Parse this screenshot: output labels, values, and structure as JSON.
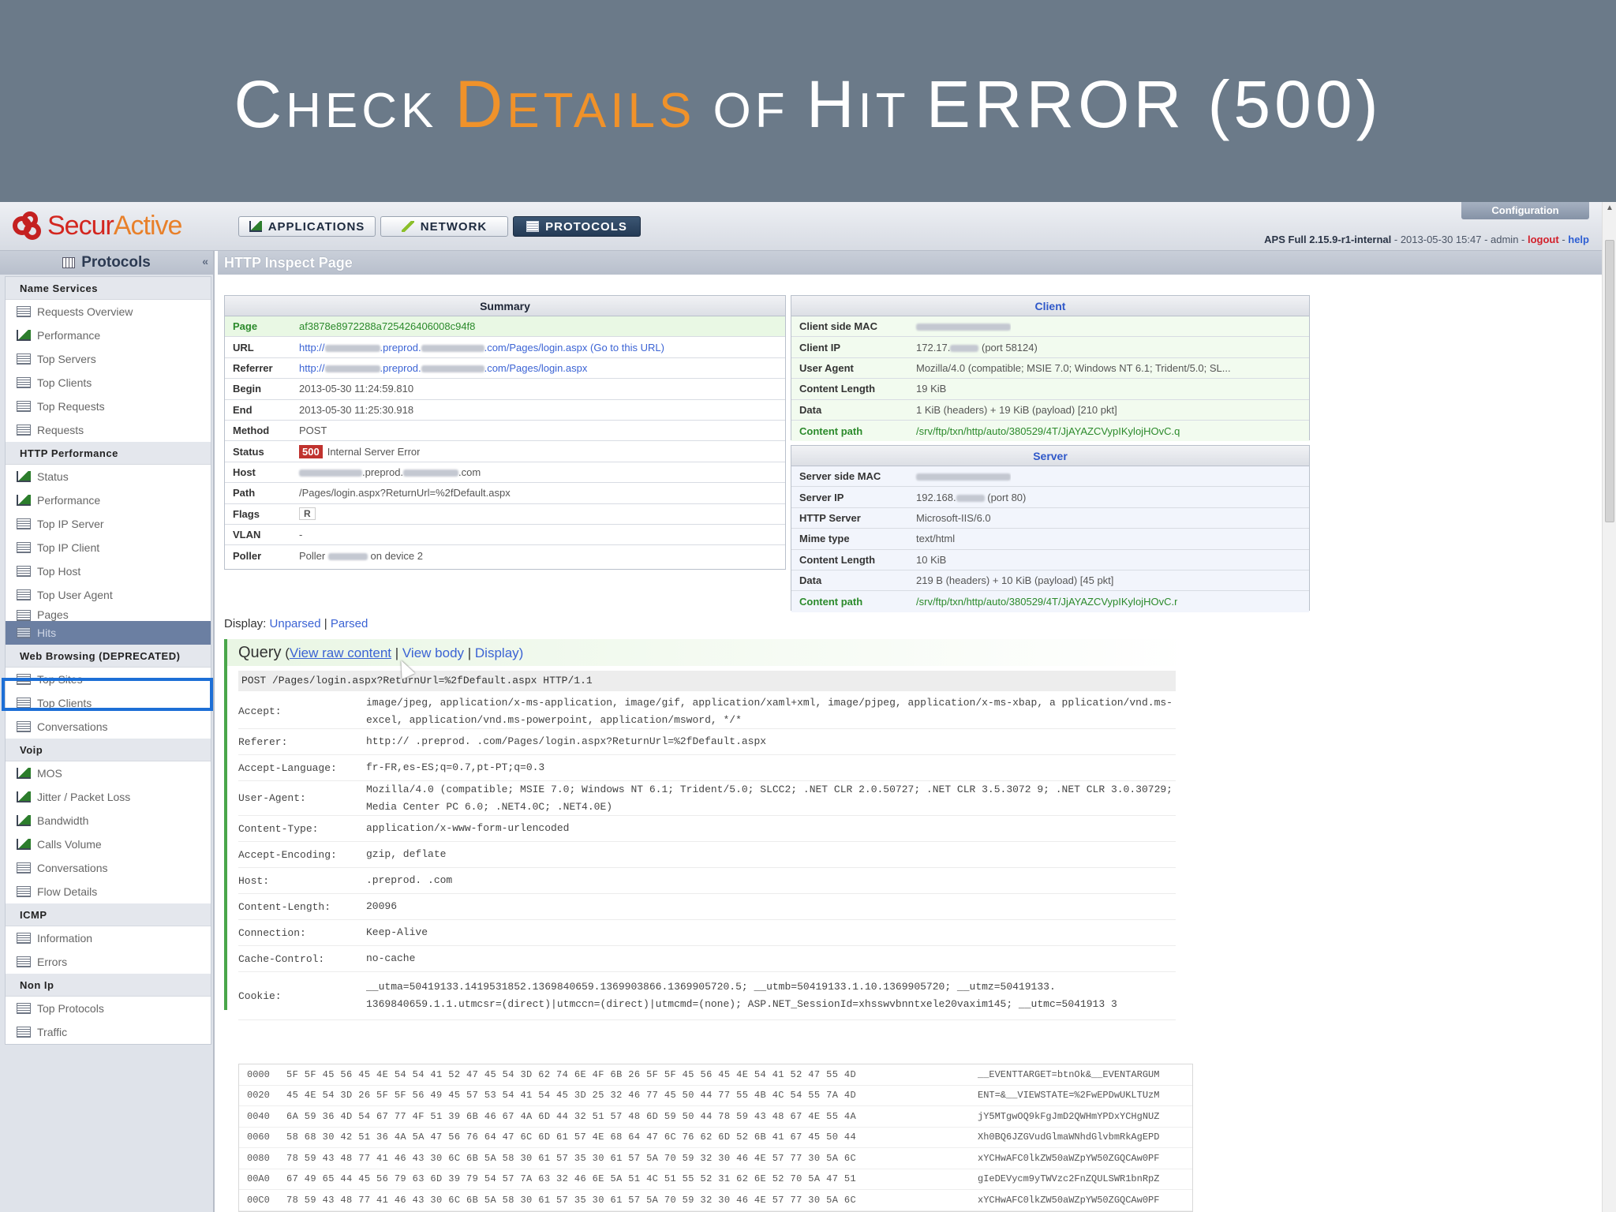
{
  "slide": {
    "title_parts": [
      "C",
      "HECK ",
      "D",
      "ETAILS",
      " OF ",
      "H",
      "IT ",
      "ERROR (500)"
    ]
  },
  "app": {
    "logo": {
      "part1": "Secur",
      "part2": "Active"
    },
    "tabs": [
      {
        "label": "APPLICATIONS",
        "icon": "chart-icon"
      },
      {
        "label": "NETWORK",
        "icon": "pencil-icon"
      },
      {
        "label": "PROTOCOLS",
        "icon": "document-icon",
        "active": true
      }
    ],
    "config_label": "Configuration",
    "status": {
      "version": "APS Full 2.15.9-r1-internal",
      "timestamp": " - 2013-05-30 15:47 - admin - ",
      "logout": "logout",
      "sep": " - ",
      "help": "help"
    }
  },
  "sidebar": {
    "title": "Protocols",
    "sections": [
      {
        "title": "Name Services",
        "items": [
          "Requests Overview",
          "Performance",
          "Top Servers",
          "Top Clients",
          "Top Requests",
          "Requests"
        ]
      },
      {
        "title": "HTTP Performance",
        "items": [
          "Status",
          "Performance",
          "Top IP Server",
          "Top IP Client",
          "Top Host",
          "Top User Agent",
          "Pages",
          "Hits"
        ]
      },
      {
        "title": "Web Browsing (DEPRECATED)",
        "items": [
          "Top Sites",
          "Top Clients",
          "Conversations"
        ]
      },
      {
        "title": "Voip",
        "items": [
          "MOS",
          "Jitter / Packet Loss",
          "Bandwidth",
          "Calls Volume",
          "Conversations",
          "Flow Details"
        ]
      },
      {
        "title": "ICMP",
        "items": [
          "Information",
          "Errors"
        ]
      },
      {
        "title": "Non Ip",
        "items": [
          "Top Protocols",
          "Traffic"
        ]
      }
    ]
  },
  "main": {
    "page_title": "HTTP Inspect Page",
    "summary": {
      "title": "Summary",
      "page_label": "Page",
      "page_value": "af3878e8972288a725426406008c94f8",
      "url_label": "URL",
      "url_prefix": "http://",
      "url_mid": ".preprod.",
      "url_suffix": ".com/Pages/login.aspx",
      "url_go": "(Go to this URL)",
      "referrer_label": "Referrer",
      "referrer_prefix": "http://",
      "referrer_mid": ".preprod.",
      "referrer_suffix": ".com/Pages/login.aspx",
      "begin_label": "Begin",
      "begin_value": "2013-05-30 11:24:59.810",
      "end_label": "End",
      "end_value": "2013-05-30 11:25:30.918",
      "method_label": "Method",
      "method_value": "POST",
      "status_label": "Status",
      "status_code": "500",
      "status_text": "Internal Server Error",
      "host_label": "Host",
      "host_mid": ".preprod.",
      "host_suffix": ".com",
      "path_label": "Path",
      "path_value": "/Pages/login.aspx?ReturnUrl=%2fDefault.aspx",
      "flags_label": "Flags",
      "flags_value": "R",
      "vlan_label": "VLAN",
      "vlan_value": "-",
      "poller_label": "Poller",
      "poller_prefix": "Poller",
      "poller_suffix": "on device 2"
    },
    "client": {
      "title": "Client",
      "mac_label": "Client side MAC",
      "ip_label": "Client IP",
      "ip_value": "172.17.",
      "ip_port": "(port 58124)",
      "ua_label": "User Agent",
      "ua_value": "Mozilla/4.0 (compatible; MSIE 7.0; Windows NT 6.1; Trident/5.0; SL...",
      "cl_label": "Content Length",
      "cl_value": "19 KiB",
      "data_label": "Data",
      "data_value": "1 KiB (headers) + 19 KiB (payload) [210 pkt]",
      "cp_label": "Content path",
      "cp_value": "/srv/ftp/txn/http/auto/380529/4T/JjAYAZCVypIKylojHOvC.q"
    },
    "server": {
      "title": "Server",
      "mac_label": "Server side MAC",
      "ip_label": "Server IP",
      "ip_value": "192.168.",
      "ip_port": "(port 80)",
      "http_label": "HTTP Server",
      "http_value": "Microsoft-IIS/6.0",
      "mime_label": "Mime type",
      "mime_value": "text/html",
      "cl_label": "Content Length",
      "cl_value": "10 KiB",
      "data_label": "Data",
      "data_value": "219 B (headers) + 10 KiB (payload) [45 pkt]",
      "cp_label": "Content path",
      "cp_value": "/srv/ftp/txn/http/auto/380529/4T/JjAYAZCVypIKylojHOvC.r"
    },
    "display": {
      "label": "Display:",
      "unparsed": "Unparsed",
      "sep": " | ",
      "parsed": "Parsed"
    },
    "query": {
      "title": "Query",
      "open": " (",
      "view_raw": "View raw content",
      "view_body": "View body",
      "display": "Display",
      "sep": " | ",
      "close": ")",
      "request_line": "POST /Pages/login.aspx?ReturnUrl=%2fDefault.aspx HTTP/1.1",
      "headers": [
        {
          "name": "Accept:",
          "value": "image/jpeg, application/x-ms-application, image/gif, application/xaml+xml, image/pjpeg, application/x-ms-xbap, a pplication/vnd.ms-excel, application/vnd.ms-powerpoint, application/msword, */*"
        },
        {
          "name": "Referer:",
          "value": "http://          .preprod.             .com/Pages/login.aspx?ReturnUrl=%2fDefault.aspx"
        },
        {
          "name": "Accept-Language:",
          "value": "fr-FR,es-ES;q=0.7,pt-PT;q=0.3"
        },
        {
          "name": "User-Agent:",
          "value": "Mozilla/4.0 (compatible; MSIE 7.0; Windows NT 6.1; Trident/5.0; SLCC2; .NET CLR 2.0.50727; .NET CLR 3.5.3072 9; .NET CLR 3.0.30729; Media Center PC 6.0; .NET4.0C; .NET4.0E)"
        },
        {
          "name": "Content-Type:",
          "value": "application/x-www-form-urlencoded"
        },
        {
          "name": "Accept-Encoding:",
          "value": "gzip, deflate"
        },
        {
          "name": "Host:",
          "value": "          .preprod.          .com"
        },
        {
          "name": "Content-Length:",
          "value": "20096"
        },
        {
          "name": "Connection:",
          "value": "Keep-Alive"
        },
        {
          "name": "Cache-Control:",
          "value": "no-cache"
        },
        {
          "name": "Cookie:",
          "value": "__utma=50419133.1419531852.1369840659.1369903866.1369905720.5; __utmb=50419133.1.10.1369905720; __utmz=50419133. 1369840659.1.1.utmcsr=(direct)|utmccn=(direct)|utmcmd=(none); ASP.NET_SessionId=xhsswvbnntxele20vaxim145; __utmc=5041913 3"
        }
      ],
      "hex": [
        {
          "offset": "0000",
          "bytes": "5F 5F 45 56 45 4E 54 54  41 52 47 45 54 3D 62 74  6E 4F 6B 26 5F 5F 45 56  45 4E 54 41 52 47 55 4D",
          "ascii": "__EVENTTARGET=btnOk&__EVENTARGUM"
        },
        {
          "offset": "0020",
          "bytes": "45 4E 54 3D 26 5F 5F 56  49 45 57 53 54 41 54 45  3D 25 32 46 77 45 50 44  77 55 4B 4C 54 55 7A 4D",
          "ascii": "ENT=&__VIEWSTATE=%2FwEPDwUKLTUzM"
        },
        {
          "offset": "0040",
          "bytes": "6A 59 36 4D 54 67 77 4F  51 39 6B 46 67 4A 6D 44  32 51 57 48 6D 59 50 44  78 59 43 48 67 4E 55 4A",
          "ascii": "jY5MTgwOQ9kFgJmD2QWHmYPDxYCHgNUZ"
        },
        {
          "offset": "0060",
          "bytes": "58 68 30 42 51 36 4A 5A  47 56 76 64 47 6C 6D 61  57 4E 68 64 47 6C 76 62  6D 52 6B 41 67 45 50 44",
          "ascii": "Xh0BQ6JZGVudGlmaWNhdGlvbmRkAgEPD"
        },
        {
          "offset": "0080",
          "bytes": "78 59 43 48 77 41 46 43  30 6C 6B 5A 58 30 61 57  35 30 61 57 5A 70 59 32 30 46 4E 57 77 30 5A 6C",
          "ascii": "xYCHwAFC0lkZW50aWZpYW50ZGQCAw0PF"
        },
        {
          "offset": "00A0",
          "bytes": "67 49 65 44 45 56 79 63  6D 39 79 54 57 7A 63 32  46 6E 5A 51 4C 51 55 52  31 62 6E 52 70 5A 47 51",
          "ascii": "gIeDEVycm9yTWVzc2FnZQULSWR1bnRpZ"
        },
        {
          "offset": "00C0",
          "bytes": "78 59 43 48 77 41 46 43  30 6C 6B 5A 58 30 61 57  35 30 61 57 5A 70 59 32 30 46 4E 57 77 30 5A 6C",
          "ascii": "xYCHwAFC0lkZW50aWZpYW50ZGQCAw0PF"
        }
      ]
    }
  }
}
